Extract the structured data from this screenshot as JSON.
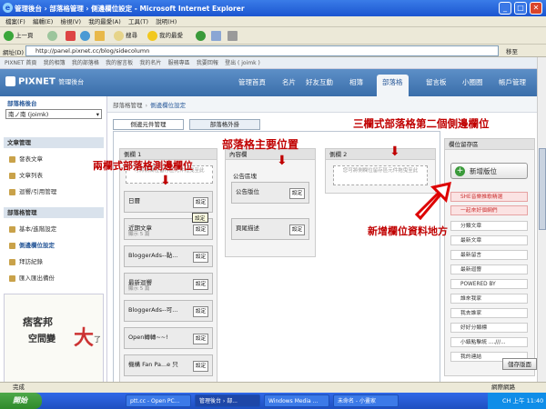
{
  "window": {
    "title": "管理後台 › 部落格管理 › 側邊欄位設定 - Microsoft Internet Explorer"
  },
  "menu": [
    "檔案(F)",
    "編輯(E)",
    "檢視(V)",
    "我的最愛(A)",
    "工具(T)",
    "說明(H)"
  ],
  "toolbar": {
    "back": "上一頁",
    "search": "搜尋",
    "favorites": "我的最愛"
  },
  "address": {
    "label": "網址(D)",
    "url": "http://panel.pixnet.cc/blog/sidecolumn",
    "go": "移至"
  },
  "top_links": [
    "PIXNET 首頁",
    "我的相簿",
    "我的部落格",
    "我的留言板",
    "我的名片",
    "服務專區",
    "我要回報",
    "登出 ( joimk )"
  ],
  "header": {
    "logo": "PIXNET",
    "logo_sub": "管理後台",
    "nav": [
      "管理首頁",
      "名片",
      "好友互動",
      "相簿",
      "部落格",
      "留言板",
      "小圈圈",
      "帳戶管理"
    ],
    "active_nav": "部落格"
  },
  "sidebar": {
    "title": "部落格後台",
    "select_value": "南ノ南 (joimk)",
    "sections": [
      {
        "title": "文章管理",
        "items": [
          "發表文章",
          "文章列表",
          "迴響/引用管理"
        ]
      },
      {
        "title": "部落格管理",
        "items": [
          "基本/進階設定",
          "側邊欄位設定",
          "拜訪紀錄",
          "匯入匯出備份"
        ]
      }
    ],
    "active_item": "側邊欄位設定",
    "ad": {
      "line1": "痞客邦",
      "line2": "空間變",
      "big": "大",
      "tail": "了"
    }
  },
  "breadcrumb": [
    "部落格管理",
    "側邊欄位設定"
  ],
  "tabs": [
    "側邊元件管理",
    "部落格外掛"
  ],
  "columns": {
    "col1": {
      "title": "側欄 1",
      "drop": "可將側欄位留存區元件拖曳至此",
      "widgets": [
        {
          "title": "日曆",
          "sub": ""
        },
        {
          "title": "近期文章",
          "sub": "顯示 5 篇"
        },
        {
          "title": "BloggerAds--黏...",
          "sub": ""
        },
        {
          "title": "最新迴響",
          "sub": "顯示 5 篇"
        },
        {
          "title": "BloggerAds--可...",
          "sub": ""
        },
        {
          "title": "Open轉轉~~!",
          "sub": ""
        },
        {
          "title": "機構 Fan Pa...e 只",
          "sub": ""
        }
      ],
      "tooltip": "設定"
    },
    "content": {
      "title": "內容欄",
      "group": "公告區塊",
      "widgets": [
        {
          "title": "公告版位"
        },
        {
          "title": "頁尾描述"
        }
      ]
    },
    "col2": {
      "title": "側欄 2",
      "drop": "您可將側欄位留存區元件拖曳至此"
    }
  },
  "setting_label": "設定",
  "right": {
    "title": "欄位留存區",
    "add_button": "新增版位",
    "items": [
      "SHE音樂推歌精選",
      "一起來好個網們",
      "分類文章",
      "最新文章",
      "最新留言",
      "最新迴響",
      "POWERED BY",
      "誰來我家",
      "我去誰家",
      "好好分類標",
      "小鎮點擊統 ....///...",
      "我的連結"
    ]
  },
  "save_button": "儲存版面",
  "annotations": {
    "left": "兩欄式部落格測邊欄位",
    "main": "部落格主要位置",
    "right": "三欄式部落格第二個側邊欄位",
    "add": "新增欄位資料地方"
  },
  "status": {
    "text": "完成",
    "zone": "網際網路"
  },
  "taskbar": {
    "start": "開始",
    "tasks": [
      "ptt.cc - Open PC...",
      "管理後台 › 部...",
      "Windows Media ...",
      "未命名 - 小畫家"
    ],
    "time": "上午 11:40",
    "lang": "CH"
  }
}
